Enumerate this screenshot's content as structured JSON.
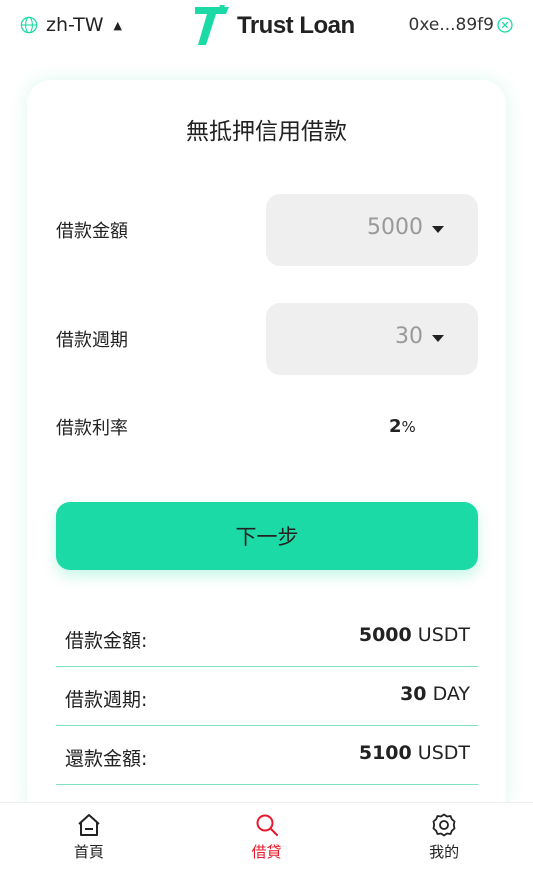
{
  "header": {
    "language": "zh-TW",
    "brand": "Trust Loan",
    "wallet_address": "0xe...89f9"
  },
  "card": {
    "title": "無抵押信用借款",
    "amount_label": "借款金額",
    "amount_value": "5000",
    "period_label": "借款週期",
    "period_value": "30",
    "rate_label": "借款利率",
    "rate_value": "2",
    "rate_unit": "%",
    "next_button": "下一步"
  },
  "summary": [
    {
      "label": "借款金額:",
      "value": "5000",
      "unit": "USDT"
    },
    {
      "label": "借款週期:",
      "value": "30",
      "unit": "DAY"
    },
    {
      "label": "還款金額:",
      "value": "5100",
      "unit": "USDT"
    }
  ],
  "nav": {
    "home": "首頁",
    "loan": "借貸",
    "mine": "我的"
  },
  "colors": {
    "accent": "#1cdaa5",
    "active_nav": "#e8192c",
    "divider": "#7fe3c5"
  }
}
